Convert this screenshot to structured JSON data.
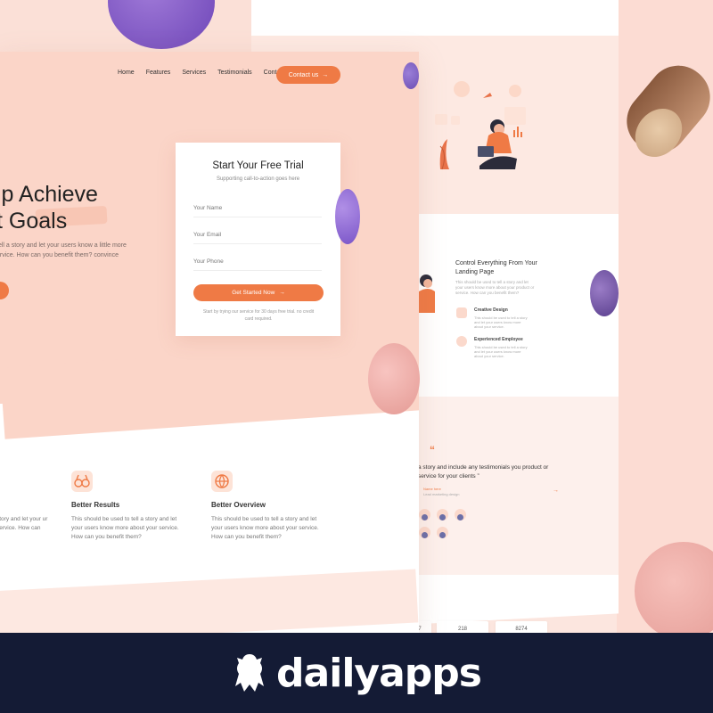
{
  "nav": {
    "items": [
      "Home",
      "Features",
      "Services",
      "Testimonials",
      "Contact"
    ],
    "cta_label": "Contact us"
  },
  "hero": {
    "title_line1": "lp Achieve",
    "title_line2": "t Goals",
    "paragraph": "tell a story and let your users know a little more ervice. How can you benefit them? convince"
  },
  "form": {
    "title": "Start Your Free Trial",
    "subtitle": "Supporting call-to-action goes here",
    "name_placeholder": "Your Name",
    "email_placeholder": "Your Email",
    "phone_placeholder": "Your Phone",
    "submit_label": "Get Started Now",
    "fine_print": "Start by trying our service for 30 days free trial. no credit card required."
  },
  "features": [
    {
      "title": "",
      "text": "story and let your ur service. How can"
    },
    {
      "title": "Better Results",
      "text": "This should be used to tell a story and let your users know more about your service. How can you benefit them?"
    },
    {
      "title": "Better Overview",
      "text": "This should be used to tell a story and let your users know more about your service. How can you benefit them?"
    }
  ],
  "right_page": {
    "control_title": "Control Everything From Your Landing Page",
    "control_text": "This should be used to tell a story and let your users know more about your product or service. How can you benefit them?",
    "mini": [
      {
        "title": "Creative Design",
        "text": "This should be used to tell a story and let your users know more about your service."
      },
      {
        "title": "Experienced Employee",
        "text": "This should be used to tell a story and let your users know more about your service."
      }
    ],
    "quote_mark": "“",
    "quote": "a story and include any testimonials you product or service for your clients ”",
    "quote_author": "Name here",
    "quote_role": "Lead marketing design",
    "stats": [
      "7",
      "218",
      "8274"
    ]
  },
  "footer": {
    "brand": "dailyapps"
  },
  "colors": {
    "accent": "#ef7a45",
    "footer_bg": "#141b35",
    "hero_bg": "#fbd5c8"
  },
  "icons": {
    "arrow": "→"
  }
}
